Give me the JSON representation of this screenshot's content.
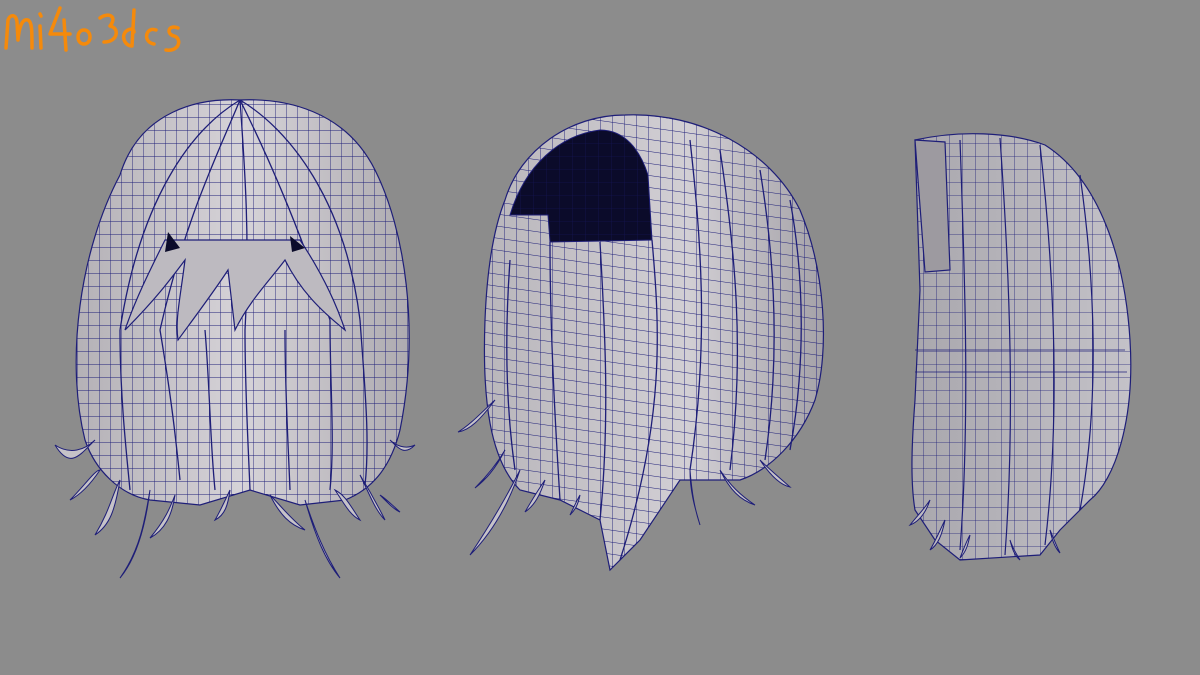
{
  "viewport": {
    "background_color": "#8c8c8c",
    "mesh_fill_color": "#c8c5c9",
    "mesh_shade_color": "#a9a6ab",
    "wireframe_color": "#1e1e78",
    "interior_color": "#0b0b2a"
  },
  "models": [
    {
      "name": "hair-front-view"
    },
    {
      "name": "hair-three-quarter-view"
    },
    {
      "name": "hair-side-view"
    }
  ],
  "watermark": {
    "text": "mi4o3dcs",
    "color": "#f58a0b"
  }
}
